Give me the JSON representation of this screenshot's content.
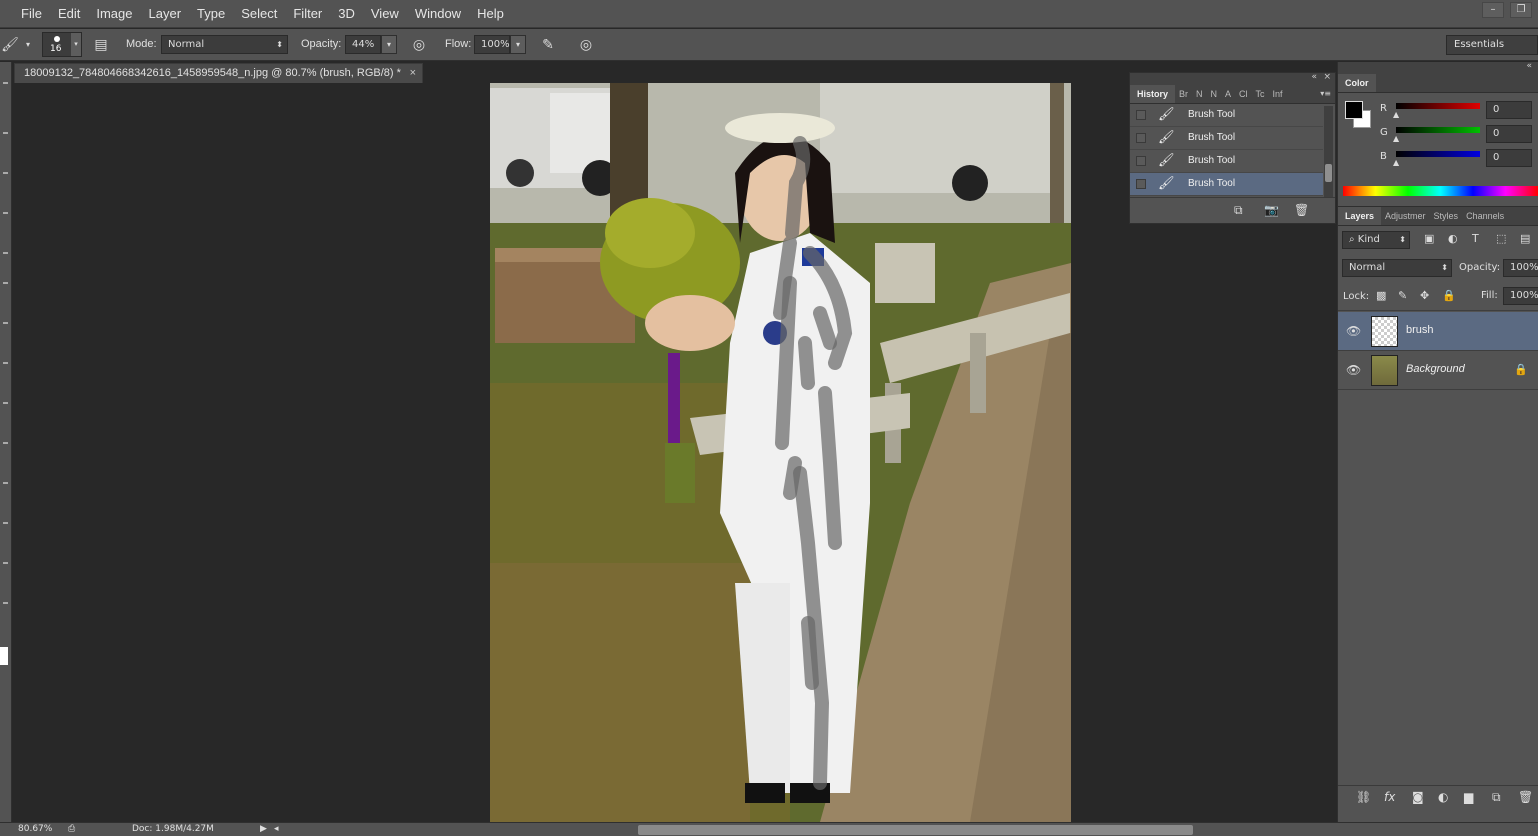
{
  "menu": [
    "File",
    "Edit",
    "Image",
    "Layer",
    "Type",
    "Select",
    "Filter",
    "3D",
    "View",
    "Window",
    "Help"
  ],
  "window_controls": {
    "minimize": "–",
    "restore": "❐"
  },
  "options_bar": {
    "brush_size": "16",
    "mode_label": "Mode:",
    "mode_value": "Normal",
    "opacity_label": "Opacity:",
    "opacity_value": "44%",
    "flow_label": "Flow:",
    "flow_value": "100%",
    "workspace": "Essentials"
  },
  "document": {
    "tab_title": "18009132_784804668342616_1458959548_n.jpg @ 80.7% (brush, RGB/8) *",
    "close": "×"
  },
  "history": {
    "tabs": [
      "History",
      "Br",
      "N",
      "N",
      "A",
      "Cl",
      "Tc",
      "Inf"
    ],
    "items": [
      "Brush Tool",
      "Brush Tool",
      "Brush Tool",
      "Brush Tool"
    ],
    "selected_index": 3
  },
  "color": {
    "tab": "Color",
    "channels": [
      {
        "name": "R",
        "value": "0",
        "color": "#e00000"
      },
      {
        "name": "G",
        "value": "0",
        "color": "#00c000"
      },
      {
        "name": "B",
        "value": "0",
        "color": "#0000e0"
      }
    ],
    "foreground": "#000000",
    "background": "#ffffff"
  },
  "layers": {
    "tabs": [
      "Layers",
      "Adjustmer",
      "Styles",
      "Channels"
    ],
    "kind_label": "Kind",
    "blend_mode": "Normal",
    "opacity_label": "Opacity:",
    "opacity_value": "100%",
    "lock_label": "Lock:",
    "fill_label": "Fill:",
    "fill_value": "100%",
    "items": [
      {
        "name": "brush",
        "selected": true,
        "locked": false
      },
      {
        "name": "Background",
        "selected": false,
        "locked": true
      }
    ]
  },
  "status": {
    "zoom": "80.67%",
    "doc": "Doc: 1.98M/4.27M"
  },
  "colors": {
    "panel": "#535353",
    "selection": "#5b6a82",
    "canvas_bg": "#282828"
  }
}
